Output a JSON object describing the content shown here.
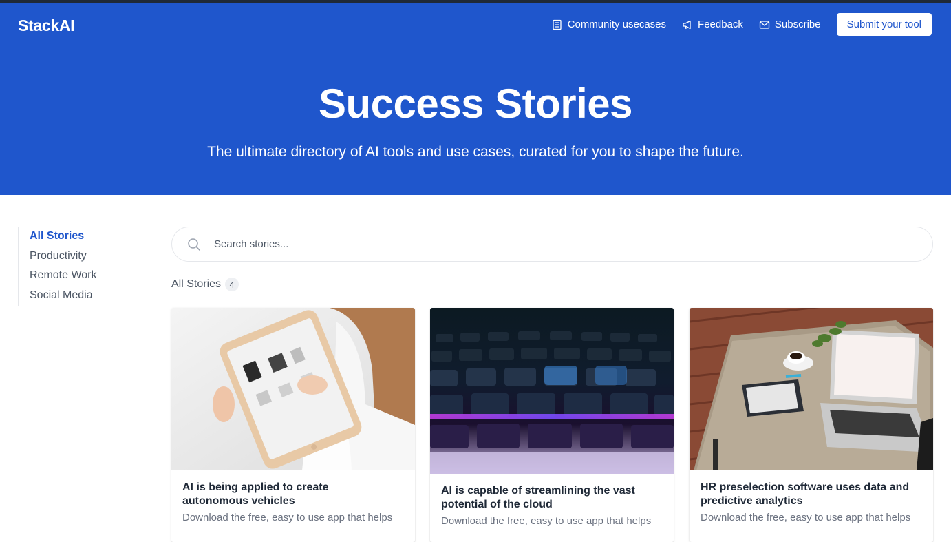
{
  "header": {
    "logo": "StackAI",
    "nav": [
      {
        "label": "Community usecases",
        "icon": "newspaper-icon"
      },
      {
        "label": "Feedback",
        "icon": "megaphone-icon"
      },
      {
        "label": "Subscribe",
        "icon": "mail-icon"
      }
    ],
    "submit_label": "Submit your tool"
  },
  "hero": {
    "title": "Success Stories",
    "subtitle": "The ultimate directory of AI tools and use cases, curated for you to shape the future."
  },
  "sidebar": {
    "items": [
      {
        "label": "All Stories",
        "active": true
      },
      {
        "label": "Productivity",
        "active": false
      },
      {
        "label": "Remote Work",
        "active": false
      },
      {
        "label": "Social Media",
        "active": false
      }
    ]
  },
  "search": {
    "placeholder": "Search stories...",
    "icon": "search-icon"
  },
  "stories": {
    "heading": "All Stories",
    "count": "4",
    "cards": [
      {
        "title_line1": "AI is being applied to create",
        "title_line2": "autonomous vehicles",
        "desc": "Download the free, easy to use app that helps",
        "image": "woman-with-tablet"
      },
      {
        "title_line1": "AI is capable of streamlining the vast",
        "title_line2": "potential of the cloud",
        "desc": "Download the free, easy to use app that helps",
        "image": "backlit-keyboard"
      },
      {
        "title_line1": "HR preselection software uses data and",
        "title_line2": "predictive analytics",
        "desc": "Download the free, easy to use app that helps",
        "image": "laptop-on-desk"
      }
    ]
  },
  "colors": {
    "brand_blue": "#1f56cc",
    "text_dark": "#1f2937",
    "text_muted": "#6b7280"
  }
}
